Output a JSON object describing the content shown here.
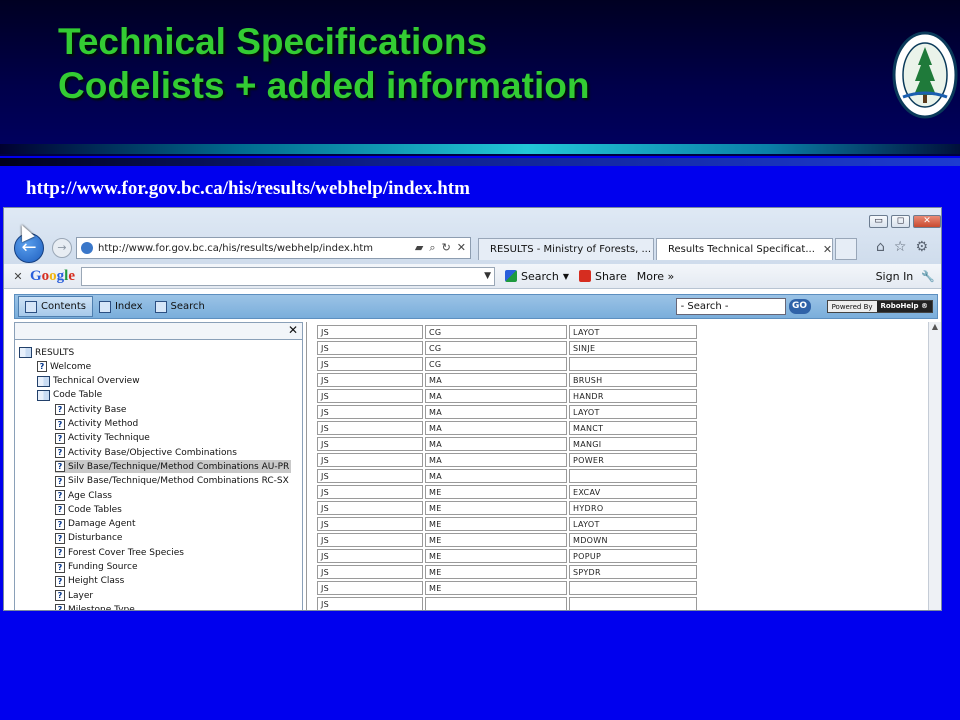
{
  "slide": {
    "title_line1": "Technical Specifications",
    "title_line2": "Codelists + added information",
    "url": "http://www.for.gov.bc.ca/his/results/webhelp/index.htm",
    "logo_text_top": "FOREST SERVICE",
    "logo_text_bottom": "BRITISH COLUMBIA"
  },
  "browser": {
    "address": "http://www.for.gov.bc.ca/his/results/webhelp/index.htm",
    "tabs": [
      {
        "label": "RESULTS - Ministry of Forests, ..."
      },
      {
        "label": "Results Technical Specificat..."
      }
    ],
    "window_controls": {
      "minimize": "▭",
      "restore": "◻",
      "close": "✕"
    }
  },
  "google_toolbar": {
    "close": "✕",
    "search_label": "Search",
    "share_label": "Share",
    "more_label": "More »",
    "signin_label": "Sign In"
  },
  "robohelp": {
    "tabs": [
      "Contents",
      "Index",
      "Search"
    ],
    "search_placeholder": "- Search -",
    "go_label": "GO",
    "badge_prefix": "Powered By",
    "badge_name": "RoboHelp ®",
    "close": "✕"
  },
  "toc": [
    {
      "label": "RESULTS",
      "type": "book"
    },
    {
      "label": "Welcome",
      "type": "page"
    },
    {
      "label": "Technical Overview",
      "type": "book"
    },
    {
      "label": "Code Table",
      "type": "book"
    },
    {
      "label": "Activity Base",
      "type": "page"
    },
    {
      "label": "Activity Method",
      "type": "page"
    },
    {
      "label": "Activity Technique",
      "type": "page"
    },
    {
      "label": "Activity Base/Objective Combinations",
      "type": "page"
    },
    {
      "label": "Silv Base/Technique/Method Combinations AU-PR",
      "type": "page",
      "selected": true
    },
    {
      "label": "Silv Base/Technique/Method Combinations RC-SX",
      "type": "page"
    },
    {
      "label": "Age Class",
      "type": "page"
    },
    {
      "label": "Code Tables",
      "type": "page"
    },
    {
      "label": "Damage Agent",
      "type": "page"
    },
    {
      "label": "Disturbance",
      "type": "page"
    },
    {
      "label": "Forest Cover Tree Species",
      "type": "page"
    },
    {
      "label": "Funding Source",
      "type": "page"
    },
    {
      "label": "Height Class",
      "type": "page"
    },
    {
      "label": "Layer",
      "type": "page"
    },
    {
      "label": "Milestone Type",
      "type": "page"
    }
  ],
  "code_rows": [
    [
      "JS",
      "CG",
      "LAYOT"
    ],
    [
      "JS",
      "CG",
      "SINJE"
    ],
    [
      "JS",
      "CG",
      ""
    ],
    [
      "JS",
      "MA",
      "BRUSH"
    ],
    [
      "JS",
      "MA",
      "HANDR"
    ],
    [
      "JS",
      "MA",
      "LAYOT"
    ],
    [
      "JS",
      "MA",
      "MANCT"
    ],
    [
      "JS",
      "MA",
      "MANGI"
    ],
    [
      "JS",
      "MA",
      "POWER"
    ],
    [
      "JS",
      "MA",
      ""
    ],
    [
      "JS",
      "ME",
      "EXCAV"
    ],
    [
      "JS",
      "ME",
      "HYDRO"
    ],
    [
      "JS",
      "ME",
      "LAYOT"
    ],
    [
      "JS",
      "ME",
      "MDOWN"
    ],
    [
      "JS",
      "ME",
      "POPUP"
    ],
    [
      "JS",
      "ME",
      "SPYDR"
    ],
    [
      "JS",
      "ME",
      ""
    ],
    [
      "JS",
      "",
      ""
    ]
  ]
}
